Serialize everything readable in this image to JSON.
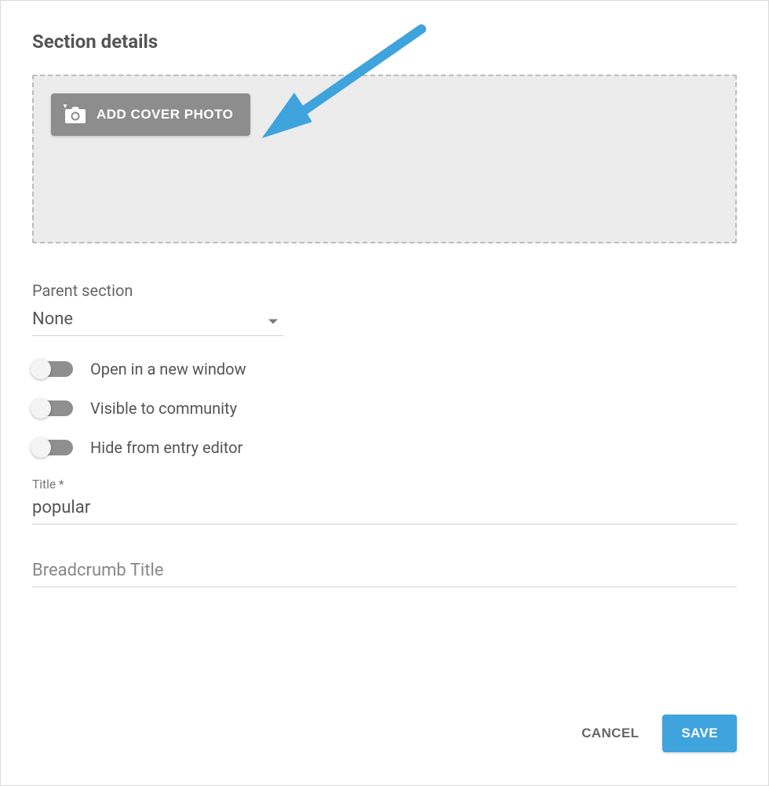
{
  "heading": "Section details",
  "cover": {
    "button_label": "ADD COVER PHOTO"
  },
  "parent_section": {
    "label": "Parent section",
    "value": "None"
  },
  "toggles": {
    "open_new_window": "Open in a new window",
    "visible_community": "Visible to community",
    "hide_entry_editor": "Hide from entry editor"
  },
  "title_field": {
    "label": "Title *",
    "value": "popular"
  },
  "breadcrumb_field": {
    "placeholder": "Breadcrumb Title",
    "value": ""
  },
  "actions": {
    "cancel": "CANCEL",
    "save": "SAVE"
  },
  "colors": {
    "accent": "#3fa3dd",
    "arrow": "#3fa3dd"
  }
}
